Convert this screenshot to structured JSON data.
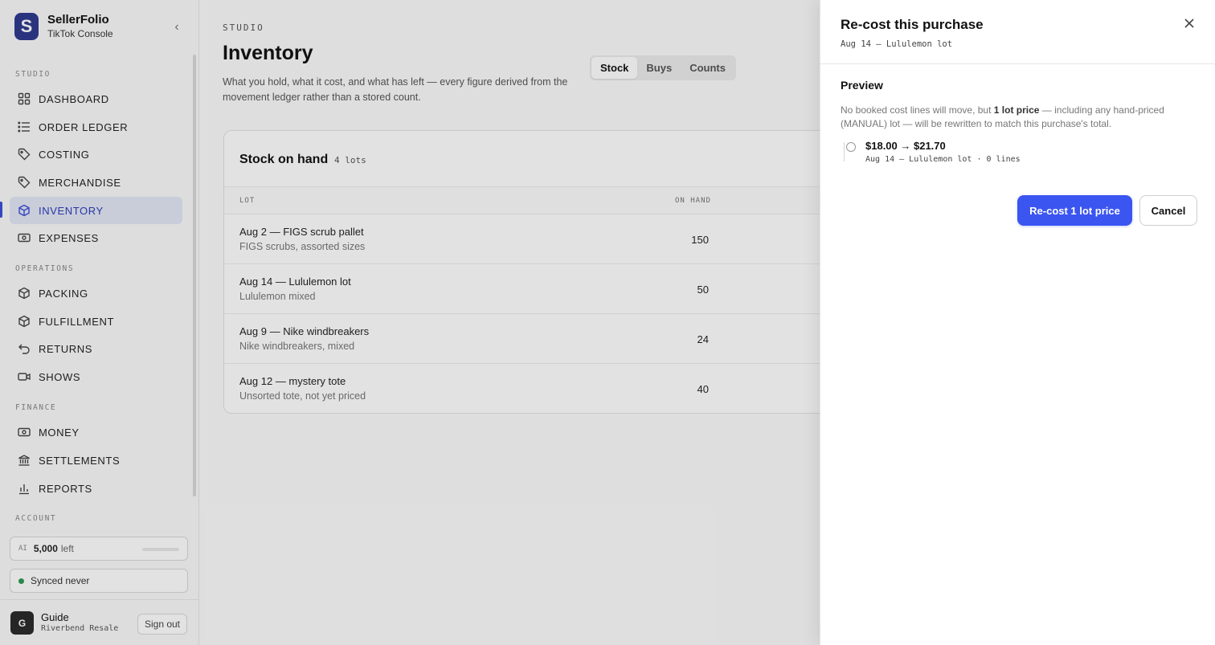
{
  "brand": {
    "name": "SellerFolio",
    "subtitle": "TikTok Console",
    "logo_letter": "S"
  },
  "sidebar": {
    "sections": {
      "studio": "STUDIO",
      "operations": "OPERATIONS",
      "finance": "FINANCE",
      "account": "ACCOUNT"
    },
    "items": [
      {
        "label": "DASHBOARD",
        "icon": "grid-icon"
      },
      {
        "label": "ORDER LEDGER",
        "icon": "list-icon"
      },
      {
        "label": "COSTING",
        "icon": "tag-icon"
      },
      {
        "label": "MERCHANDISE",
        "icon": "tag-icon"
      },
      {
        "label": "INVENTORY",
        "icon": "cube-icon",
        "active": true
      },
      {
        "label": "EXPENSES",
        "icon": "banknote-icon"
      },
      {
        "label": "PACKING",
        "icon": "cube-icon"
      },
      {
        "label": "FULFILLMENT",
        "icon": "cube-icon"
      },
      {
        "label": "RETURNS",
        "icon": "undo-icon"
      },
      {
        "label": "SHOWS",
        "icon": "video-icon"
      },
      {
        "label": "MONEY",
        "icon": "banknote-icon"
      },
      {
        "label": "SETTLEMENTS",
        "icon": "bank-icon"
      },
      {
        "label": "REPORTS",
        "icon": "bar-chart-icon"
      }
    ],
    "ai": {
      "tag": "AI",
      "count": "5,000",
      "suffix": "left"
    },
    "sync": {
      "text": "Synced never",
      "status_color": "#2e9a52"
    },
    "user": {
      "initial": "G",
      "name": "Guide",
      "org": "Riverbend Resale",
      "signout": "Sign out"
    }
  },
  "main": {
    "eyebrow": "STUDIO",
    "title": "Inventory",
    "description": "What you hold, what it cost, and what has left — every figure derived from the movement ledger rather than a stored count.",
    "tabs": [
      {
        "label": "Stock",
        "active": true
      },
      {
        "label": "Buys"
      },
      {
        "label": "Counts"
      }
    ],
    "card": {
      "title": "Stock on hand",
      "count": "4 lots",
      "columns": {
        "lot": "LOT",
        "on_hand": "ON HAND"
      },
      "rows": [
        {
          "title": "Aug 2 — FIGS scrub pallet",
          "sub": "FIGS scrubs, assorted sizes",
          "on_hand": "150"
        },
        {
          "title": "Aug 14 — Lululemon lot",
          "sub": "Lululemon mixed",
          "on_hand": "50"
        },
        {
          "title": "Aug 9 — Nike windbreakers",
          "sub": "Nike windbreakers, mixed",
          "on_hand": "24"
        },
        {
          "title": "Aug 12 — mystery tote",
          "sub": "Unsorted tote, not yet priced",
          "on_hand": "40"
        }
      ]
    }
  },
  "drawer": {
    "title": "Re-cost this purchase",
    "subtitle": "Aug 14 — Lululemon lot",
    "preview_heading": "Preview",
    "preview_text_1": "No booked cost lines will move, but ",
    "preview_text_bold": "1 lot price",
    "preview_text_2": " — including any hand-priced (MANUAL) lot — will be rewritten to match this purchase's total.",
    "change_main": "$18.00 → $21.70",
    "change_sub": "Aug 14 — Lululemon lot · 0 lines",
    "primary_button": "Re-cost 1 lot price",
    "cancel_button": "Cancel",
    "accent": "#3b55f0"
  }
}
